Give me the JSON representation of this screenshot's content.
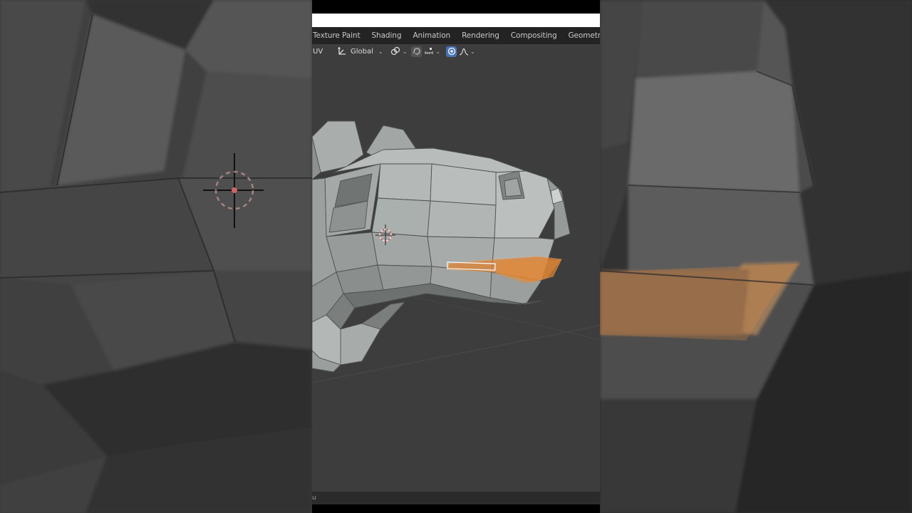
{
  "workspace_tabs": [
    "Texture Paint",
    "Shading",
    "Animation",
    "Rendering",
    "Compositing",
    "Geometry Nodes"
  ],
  "header": {
    "mode_label": "UV",
    "orientation_label": "Global"
  },
  "icons": {
    "orientation": "transform-orientation-icon",
    "pivot": "pivot-link-icon",
    "snap": "snap-icon",
    "snap_target": "snap-target-icon",
    "proportional": "proportional-editing-icon",
    "falloff": "falloff-curve-icon",
    "cursor": "3d-cursor-icon"
  },
  "status": {
    "text": "u"
  },
  "colors": {
    "selection_orange": "#e0802c",
    "accent_blue": "#4772b3",
    "mesh_gray": "#a8adac",
    "viewport_bg": "#3d3d3d"
  }
}
